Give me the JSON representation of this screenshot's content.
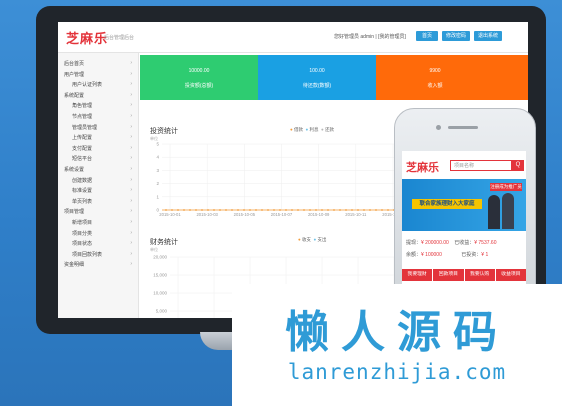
{
  "header": {
    "logo": "芝麻乐",
    "subtitle": "后台管理后台",
    "welcome": "您好管理员 admin | [我的管理员]",
    "buttons": [
      "首页",
      "修改密码",
      "退出系统"
    ]
  },
  "sidebar": {
    "items": [
      {
        "label": "后台首页",
        "indent": false
      },
      {
        "label": "用户管理",
        "indent": false
      },
      {
        "label": "用户认证列表",
        "indent": true
      },
      {
        "label": "系统配置",
        "indent": false
      },
      {
        "label": "角色管理",
        "indent": true
      },
      {
        "label": "节点管理",
        "indent": true
      },
      {
        "label": "管理员管理",
        "indent": true
      },
      {
        "label": "上传配置",
        "indent": true
      },
      {
        "label": "支付配置",
        "indent": true
      },
      {
        "label": "短信平台",
        "indent": true
      },
      {
        "label": "系统设置",
        "indent": false
      },
      {
        "label": "创建数据",
        "indent": true
      },
      {
        "label": "标准设置",
        "indent": true
      },
      {
        "label": "单页列表",
        "indent": true
      },
      {
        "label": "项目管理",
        "indent": false
      },
      {
        "label": "新增项目",
        "indent": true
      },
      {
        "label": "项目分类",
        "indent": true
      },
      {
        "label": "项目状态",
        "indent": true
      },
      {
        "label": "项目回款列表",
        "indent": true
      },
      {
        "label": "资金明细",
        "indent": false
      }
    ]
  },
  "stats": [
    {
      "value": "10000.00",
      "label": "投资额(总额)",
      "color": "#2ecc71"
    },
    {
      "value": "100.00",
      "label": "待还款(数额)",
      "color": "#1aa0e3"
    },
    {
      "value": "9900",
      "label": "收入额",
      "color": "#ff6a0a"
    }
  ],
  "chart1": {
    "title": "投资统计",
    "subtitle": "单位",
    "legend": [
      "借款",
      "利息",
      "还款"
    ],
    "legend_colors": [
      "#f39c3a",
      "#6fc3e8",
      "#b7b7b7"
    ],
    "chart_data": {
      "type": "line",
      "x": [
        "2015-10-01",
        "2015-10-03",
        "2015-10-05",
        "2015-10-07",
        "2015-10-09",
        "2015-10-11",
        "2015-10-13"
      ],
      "ylim": [
        0,
        5
      ],
      "yticks": [
        "5",
        "4",
        "3",
        "2",
        "1",
        "0"
      ]
    }
  },
  "chart2": {
    "title": "财务统计",
    "subtitle": "单位",
    "legend": [
      "收支",
      "支出"
    ],
    "legend_colors": [
      "#f39c3a",
      "#6fc3e8"
    ],
    "chart_data": {
      "type": "line",
      "ylim": [
        0,
        20000
      ],
      "yticks": [
        "20,000",
        "15,000",
        "10,000",
        "5,000"
      ]
    }
  },
  "phone": {
    "logo": "芝麻乐",
    "search_placeholder": "项目名称",
    "search_button": "Q",
    "banner_title": "联合家族理财入大家庭",
    "banner_tag": "注册成为推广员",
    "row1": [
      "提现：",
      "¥ 200000.00",
      "已收益：",
      "¥ 7537.60"
    ],
    "row2": [
      "余额：",
      "¥ 100000",
      "已投资：",
      "¥ 1"
    ],
    "nav": [
      "我要理财",
      "回款项目",
      "我要认购",
      "收益项目"
    ]
  },
  "watermark": {
    "big": "懒人源码",
    "small": "lanrenzhijia.com"
  }
}
